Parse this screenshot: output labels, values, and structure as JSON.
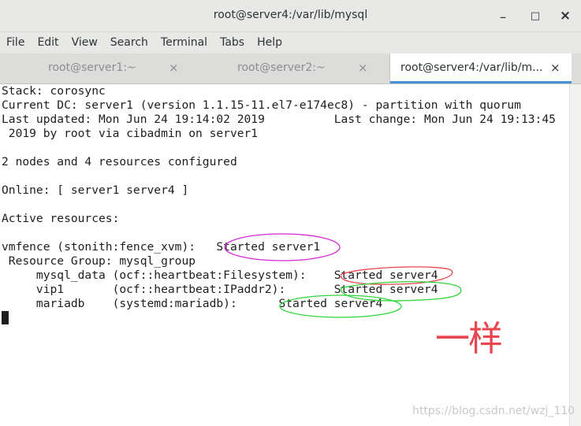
{
  "window": {
    "title": "root@server4:/var/lib/mysql",
    "controls": {
      "minimize": "_",
      "maximize": "□",
      "close": "×"
    }
  },
  "menu": [
    "File",
    "Edit",
    "View",
    "Search",
    "Terminal",
    "Tabs",
    "Help"
  ],
  "tabs": [
    {
      "label": "root@server1:~",
      "close": "×",
      "active": false
    },
    {
      "label": "root@server2:~",
      "close": "×",
      "active": false
    },
    {
      "label": "root@server4:/var/lib/m...",
      "close": "×",
      "active": true
    }
  ],
  "terminal": {
    "lines": [
      "Stack: corosync",
      "Current DC: server1 (version 1.1.15-11.el7-e174ec8) - partition with quorum",
      "Last updated: Mon Jun 24 19:14:02 2019          Last change: Mon Jun 24 19:13:45",
      " 2019 by root via cibadmin on server1",
      "",
      "2 nodes and 4 resources configured",
      "",
      "Online: [ server1 server4 ]",
      "",
      "Active resources:",
      "",
      "vmfence (stonith:fence_xvm):   Started server1",
      " Resource Group: mysql_group",
      "     mysql_data (ocf::heartbeat:Filesystem):    Started server4",
      "     vip1       (ocf::heartbeat:IPaddr2):       Started server4",
      "     mariadb    (systemd:mariadb):      Started server4"
    ]
  },
  "annotations": {
    "handwritten_note": "一样",
    "colors": {
      "magenta": "#d42ad4",
      "red": "#e8454f",
      "green": "#2fd43a"
    }
  },
  "watermark": "https://blog.csdn.net/wzj_110"
}
